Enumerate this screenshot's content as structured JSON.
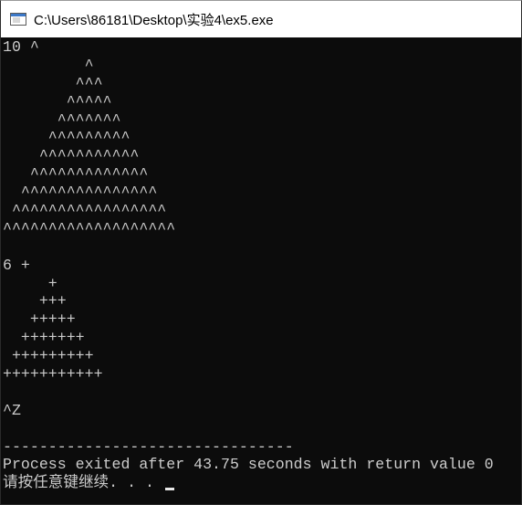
{
  "window": {
    "title": "C:\\Users\\86181\\Desktop\\实验4\\ex5.exe",
    "icon": "console-app-icon"
  },
  "console": {
    "lines": [
      "10 ^",
      "         ^",
      "        ^^^",
      "       ^^^^^",
      "      ^^^^^^^",
      "     ^^^^^^^^^",
      "    ^^^^^^^^^^^",
      "   ^^^^^^^^^^^^^",
      "  ^^^^^^^^^^^^^^^",
      " ^^^^^^^^^^^^^^^^^",
      "^^^^^^^^^^^^^^^^^^^",
      "",
      "6 +",
      "     +",
      "    +++",
      "   +++++",
      "  +++++++",
      " +++++++++",
      "+++++++++++",
      "",
      "^Z",
      "",
      "--------------------------------",
      "Process exited after 43.75 seconds with return value 0",
      "请按任意键继续. . . "
    ]
  },
  "colors": {
    "console_bg": "#0c0c0c",
    "console_fg": "#cccccc",
    "titlebar_bg": "#ffffff"
  }
}
